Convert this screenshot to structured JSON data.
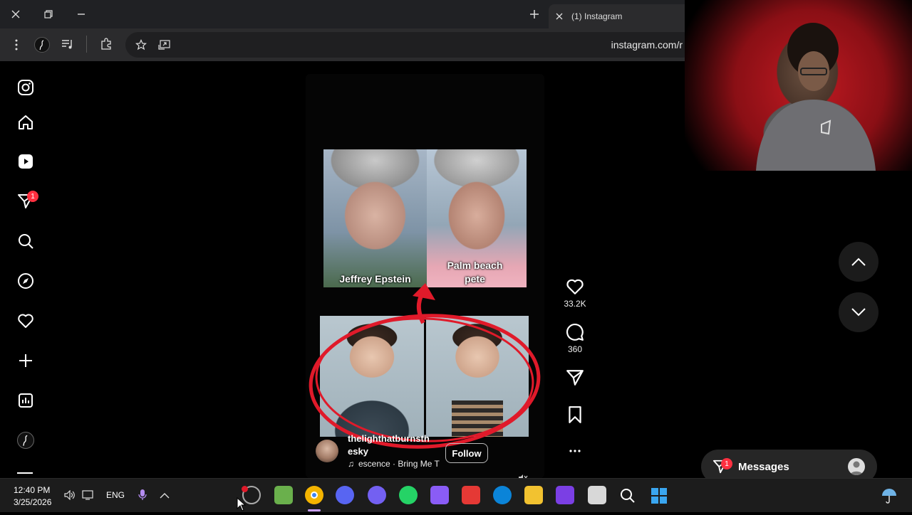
{
  "browser": {
    "tab_title": "(1) Instagram",
    "url": "instagram.com/r"
  },
  "sidebar": {
    "notification_count": "1"
  },
  "reel": {
    "caption_left": "Jeffrey Epstein",
    "caption_right": "Palm beach pete",
    "username": "thelighthatburnsthesky",
    "username_line1": "thelighthatburnsth",
    "username_line2": "esky",
    "follow_label": "Follow",
    "audio": "escence · Bring Me T"
  },
  "actions": {
    "likes": "33.2K",
    "comments": "360"
  },
  "messages": {
    "label": "Messages",
    "count": "1"
  },
  "taskbar": {
    "time": "12:40 PM",
    "date": "3/25/2026",
    "language": "ENG"
  },
  "colors": {
    "accent_red": "#ff3040",
    "background": "#000000"
  }
}
